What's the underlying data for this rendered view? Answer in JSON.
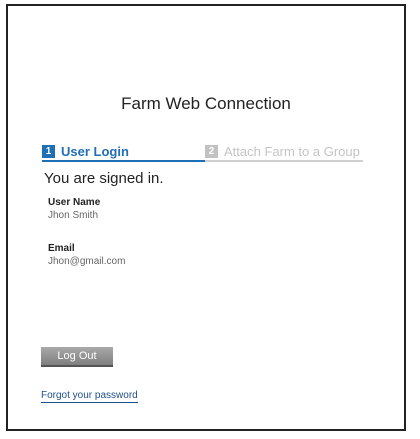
{
  "header": {
    "title": "Farm Web Connection"
  },
  "steps": [
    {
      "number": "1",
      "label": "User Login",
      "active": true
    },
    {
      "number": "2",
      "label": "Attach Farm to a Group",
      "active": false
    }
  ],
  "status": {
    "message": "You are signed in."
  },
  "user": {
    "name_label": "User Name",
    "name_value": "Jhon Smith",
    "email_label": "Email",
    "email_value": "Jhon@gmail.com"
  },
  "actions": {
    "logout_label": "Log Out",
    "forgot_password_label": "Forgot your password"
  },
  "colors": {
    "accent": "#1f6fb6",
    "inactive": "#c2c2c2",
    "button": "#8f8f8f"
  }
}
